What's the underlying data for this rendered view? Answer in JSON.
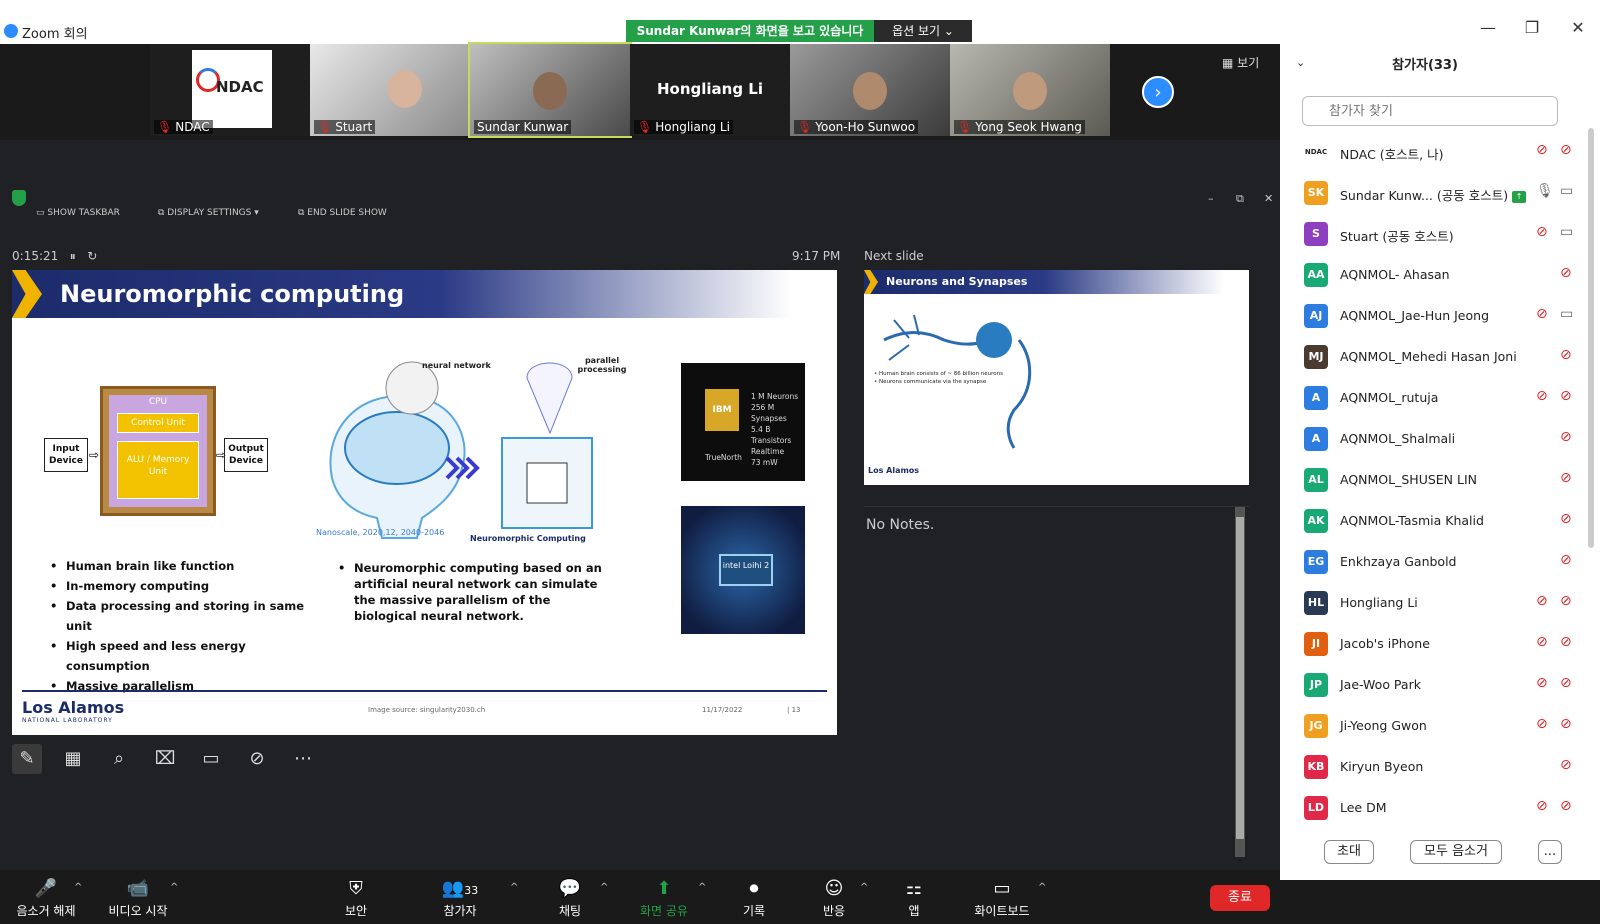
{
  "titlebar": {
    "title": "Zoom 회의",
    "minimize": "—",
    "restore": "❐",
    "close": "✕"
  },
  "share_banner": {
    "text": "Sundar Kunwar의 화면을 보고 있습니다",
    "options": "옵션 보기 ⌄"
  },
  "thumbnails": [
    {
      "name": "NDAC",
      "logo_text": "NDAC",
      "muted": true
    },
    {
      "name": "Stuart",
      "muted": true
    },
    {
      "name": "Sundar Kunwar",
      "muted": false,
      "active": true
    },
    {
      "name": "Hongliang Li",
      "display": "Hongliang Li",
      "muted": true
    },
    {
      "name": "Yoon-Ho Sunwoo",
      "muted": true
    },
    {
      "name": "Yong Seok Hwang",
      "muted": true
    }
  ],
  "view_button": "▦ 보기",
  "presenter": {
    "tools": [
      "SHOW TASKBAR",
      "DISPLAY SETTINGS ▾",
      "END SLIDE SHOW"
    ],
    "timer": "0:15:21",
    "pause": "⏸",
    "reset": "↻",
    "clock": "9:17 PM",
    "next_slide_label": "Next slide",
    "notes": "No Notes."
  },
  "slide": {
    "title": "Neuromorphic computing",
    "cpu": "CPU",
    "control_unit": "Control Unit",
    "alu": "ALU / Memory Unit",
    "input": "Input Device",
    "output": "Output Device",
    "neural_network": "neural network",
    "parallel": "parallel processing",
    "nanoscale": "Nanoscale, 2020,12, 2040-2046",
    "neuromorphic_label": "Neuromorphic Computing",
    "bullets_left": [
      "Human brain like function",
      "In-memory computing",
      "Data processing and storing in same unit",
      "High speed and less energy consumption",
      "Massive parallelism"
    ],
    "bullet_right": "Neuromorphic computing based on an artificial neural network can simulate the massive parallelism of the biological neural network.",
    "ibm_chip": "IBM",
    "ibm_specs": [
      "1 M Neurons",
      "256 M Synapses",
      "5.4 B Transistors",
      "Realtime",
      "73 mW"
    ],
    "truenorth": "TrueNorth",
    "loihi_chip": "intel Loihi 2",
    "logo": "Los Alamos",
    "logo_sub": "NATIONAL LABORATORY",
    "source": "Image source: singularity2030.ch",
    "date": "11/17/2022",
    "page": "| 13"
  },
  "next_slide": {
    "title": "Neurons and Synapses",
    "text": [
      "Human brain consists of ~ 86 billion neurons",
      "Neurons communicate via the synapse"
    ],
    "logo": "Los Alamos"
  },
  "toolbar": {
    "items": [
      {
        "label": "음소거 해제",
        "icon": "🎤"
      },
      {
        "label": "비디오 시작",
        "icon": "📹"
      },
      {
        "label": "보안",
        "icon": "⛨"
      },
      {
        "label": "참가자",
        "icon": "👥",
        "count": "33"
      },
      {
        "label": "채팅",
        "icon": "💬"
      },
      {
        "label": "화면 공유",
        "icon": "⬆"
      },
      {
        "label": "기록",
        "icon": "⏺"
      },
      {
        "label": "반응",
        "icon": "☺"
      },
      {
        "label": "앱",
        "icon": "⚏"
      },
      {
        "label": "화이트보드",
        "icon": "▭"
      }
    ],
    "end": "종료"
  },
  "participants": {
    "header": "참가자(33)",
    "search_placeholder": "참가자 찾기",
    "list": [
      {
        "initials": "NDAC",
        "name": "NDAC (호스트, 나)",
        "color": "#ffffff",
        "mic": "muted",
        "video": "off"
      },
      {
        "initials": "SK",
        "name": "Sundar Kunw... (공동 호스트)",
        "color": "#f0a020",
        "mic": "on",
        "video": "on",
        "sharing": true
      },
      {
        "initials": "S",
        "name": "Stuart (공동 호스트)",
        "color": "#8e3fbf",
        "mic": "muted",
        "video": "on"
      },
      {
        "initials": "AA",
        "name": "AQNMOL- Ahasan",
        "color": "#19a974",
        "mic": "muted",
        "video": "none"
      },
      {
        "initials": "AJ",
        "name": "AQNMOL_Jae-Hun Jeong",
        "color": "#2d7de0",
        "mic": "muted",
        "video": "on"
      },
      {
        "initials": "MJ",
        "name": "AQNMOL_Mehedi Hasan Joni",
        "color": "#4a3a30",
        "mic": "muted",
        "video": "none"
      },
      {
        "initials": "A",
        "name": "AQNMOL_rutuja",
        "color": "#2d7de0",
        "mic": "muted",
        "video": "off"
      },
      {
        "initials": "A",
        "name": "AQNMOL_Shalmali",
        "color": "#2d7de0",
        "mic": "muted",
        "video": "none"
      },
      {
        "initials": "AL",
        "name": "AQNMOL_SHUSEN LIN",
        "color": "#19a974",
        "mic": "muted",
        "video": "none"
      },
      {
        "initials": "AK",
        "name": "AQNMOL-Tasmia Khalid",
        "color": "#19a974",
        "mic": "muted",
        "video": "none"
      },
      {
        "initials": "EG",
        "name": "Enkhzaya Ganbold",
        "color": "#2d7de0",
        "mic": "muted",
        "video": "none"
      },
      {
        "initials": "HL",
        "name": "Hongliang Li",
        "color": "#2a3a55",
        "mic": "muted",
        "video": "off"
      },
      {
        "initials": "JI",
        "name": "Jacob's iPhone",
        "color": "#e06010",
        "mic": "muted",
        "video": "off"
      },
      {
        "initials": "JP",
        "name": "Jae-Woo Park",
        "color": "#19a974",
        "mic": "muted",
        "video": "off"
      },
      {
        "initials": "JG",
        "name": "Ji-Yeong Gwon",
        "color": "#f0a020",
        "mic": "muted",
        "video": "off"
      },
      {
        "initials": "KB",
        "name": "Kiryun Byeon",
        "color": "#e02848",
        "mic": "muted",
        "video": "none"
      },
      {
        "initials": "LD",
        "name": "Lee DM",
        "color": "#e02848",
        "mic": "muted",
        "video": "off"
      }
    ],
    "invite": "초대",
    "mute_all": "모두 음소거",
    "more": "..."
  }
}
